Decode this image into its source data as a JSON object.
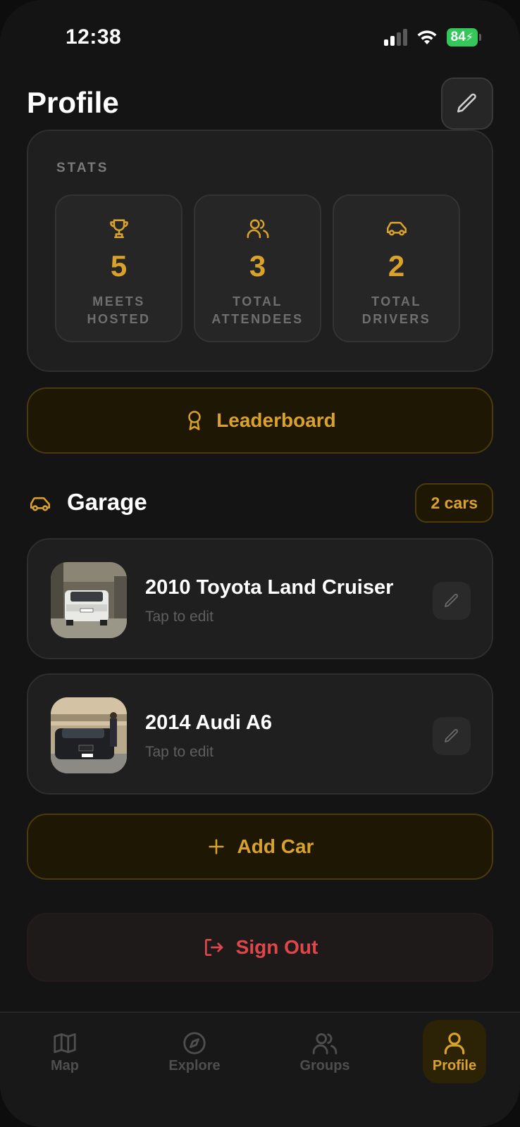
{
  "status_bar": {
    "time": "12:38",
    "battery": "84"
  },
  "header": {
    "title": "Profile"
  },
  "stats": {
    "label": "STATS",
    "items": [
      {
        "icon": "trophy-icon",
        "value": "5",
        "caption": "MEETS HOSTED"
      },
      {
        "icon": "users-icon",
        "value": "3",
        "caption": "TOTAL ATTENDEES"
      },
      {
        "icon": "car-icon",
        "value": "2",
        "caption": "TOTAL DRIVERS"
      }
    ]
  },
  "leaderboard": {
    "label": "Leaderboard"
  },
  "garage": {
    "title": "Garage",
    "count_badge": "2 cars",
    "cars": [
      {
        "name": "2010 Toyota Land Cruiser",
        "subtitle": "Tap to edit"
      },
      {
        "name": "2014 Audi A6",
        "subtitle": "Tap to edit"
      }
    ],
    "add_label": "Add Car"
  },
  "sign_out": {
    "label": "Sign Out"
  },
  "tabs": [
    {
      "label": "Map",
      "icon": "map-icon"
    },
    {
      "label": "Explore",
      "icon": "compass-icon"
    },
    {
      "label": "Groups",
      "icon": "users-icon"
    },
    {
      "label": "Profile",
      "icon": "person-icon",
      "active": true
    }
  ],
  "colors": {
    "accent": "#d9a22a",
    "danger": "#e0474a",
    "background": "#141414",
    "card": "#1f1f1f"
  }
}
